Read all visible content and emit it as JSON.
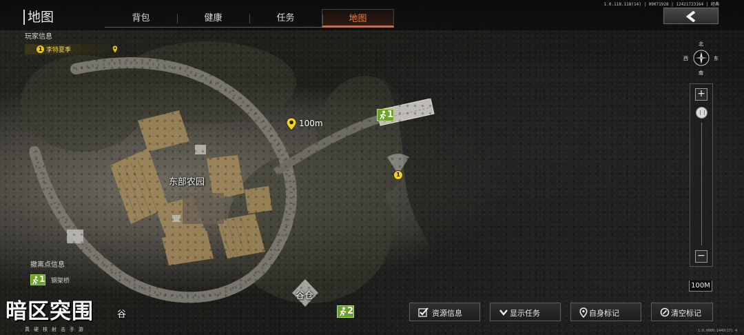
{
  "screen_title": "地图",
  "tabs": [
    {
      "label": "背包",
      "active": false
    },
    {
      "label": "健康",
      "active": false
    },
    {
      "label": "任务",
      "active": false
    },
    {
      "label": "地图",
      "active": true
    }
  ],
  "version": "1.0.118.118(14) | 09071928 | 12421723164 | 经典",
  "player_info": {
    "title": "玩家信息",
    "player_number": "1",
    "player_name": "李特夏季"
  },
  "extraction_info": {
    "title": "撤离点信息",
    "exit_number": "1",
    "exit_name": "钢架桥"
  },
  "map": {
    "area_label": "东部农园",
    "barn_label": "谷仓",
    "partial_label": "谷",
    "waypoint_distance": "100m",
    "player_marker_number": "1",
    "exit_marker_1": "1",
    "exit_marker_2": "2"
  },
  "compass": {
    "north": "北",
    "south": "南",
    "west": "西",
    "east": "东"
  },
  "zoom": {
    "plus": "+",
    "minus": "−",
    "scale_label": "100M"
  },
  "bottom_buttons": [
    {
      "label": "资源信息",
      "icon": "checkbox-icon"
    },
    {
      "label": "显示任务",
      "icon": "chevron-down-icon"
    },
    {
      "label": "自身标记",
      "icon": "location-pin-icon"
    },
    {
      "label": "清空标记",
      "icon": "clear-marker-icon"
    }
  ],
  "logo": {
    "main": "暗区突围",
    "sub": "真硬核射击手游"
  },
  "bottom_version": "1.0.0000.1449(17) 4",
  "colors": {
    "accent": "#e8622a",
    "player": "#e7c61a",
    "exit": "#6ba229"
  }
}
